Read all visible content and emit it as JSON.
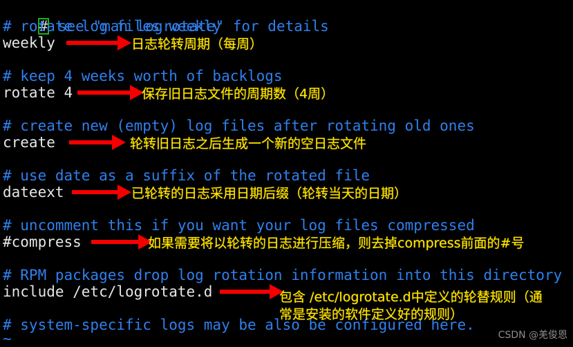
{
  "terminal": {
    "background_color": "#000000",
    "comment_color": "#2f80ed",
    "directive_color": "#e6e6e6",
    "cursor_border_color": "#18b218",
    "lines": [
      {
        "text": "# see \"man logrotate\" for details",
        "kind": "comment",
        "cursor_first_char": true
      },
      {
        "text": "# rotate log files weekly",
        "kind": "comment"
      },
      {
        "text": "weekly",
        "kind": "directive"
      },
      {
        "text": "",
        "kind": "blank"
      },
      {
        "text": "# keep 4 weeks worth of backlogs",
        "kind": "comment"
      },
      {
        "text": "rotate 4",
        "kind": "directive"
      },
      {
        "text": "",
        "kind": "blank"
      },
      {
        "text": "# create new (empty) log files after rotating old ones",
        "kind": "comment"
      },
      {
        "text": "create",
        "kind": "directive"
      },
      {
        "text": "",
        "kind": "blank"
      },
      {
        "text": "# use date as a suffix of the rotated file",
        "kind": "comment"
      },
      {
        "text": "dateext",
        "kind": "directive"
      },
      {
        "text": "",
        "kind": "blank"
      },
      {
        "text": "# uncomment this if you want your log files compressed",
        "kind": "comment"
      },
      {
        "text": "#compress",
        "kind": "directive"
      },
      {
        "text": "",
        "kind": "blank"
      },
      {
        "text": "# RPM packages drop log rotation information into this directory",
        "kind": "comment"
      },
      {
        "text": "include /etc/logrotate.d",
        "kind": "directive"
      },
      {
        "text": "",
        "kind": "blank"
      },
      {
        "text": "# system-specific logs may be also be configured here.",
        "kind": "comment"
      },
      {
        "text": "~",
        "kind": "tilde"
      }
    ]
  },
  "annotations": {
    "arrow_color": "#f50000",
    "text_color": "#ffe400",
    "items": [
      {
        "target": "weekly",
        "text": "日志轮转周期（每周）"
      },
      {
        "target": "rotate 4",
        "text": "保存旧日志文件的周期数（4周）"
      },
      {
        "target": "create",
        "text": "轮转旧日志之后生成一个新的空日志文件"
      },
      {
        "target": "dateext",
        "text": "已轮转的日志采用日期后缀（轮转当天的日期）"
      },
      {
        "target": "#compress",
        "text": "如果需要将以轮转的日志进行压缩，则去掉compress前面的#号"
      },
      {
        "target": "include /etc/logrotate.d",
        "text": "包含 /etc/logrotate.d中定义的轮替规则（通\n常是安装的软件定义好的规则）"
      }
    ]
  },
  "watermark": {
    "text": "CSDN @羌俊恩",
    "color": "#8d8d8d"
  }
}
